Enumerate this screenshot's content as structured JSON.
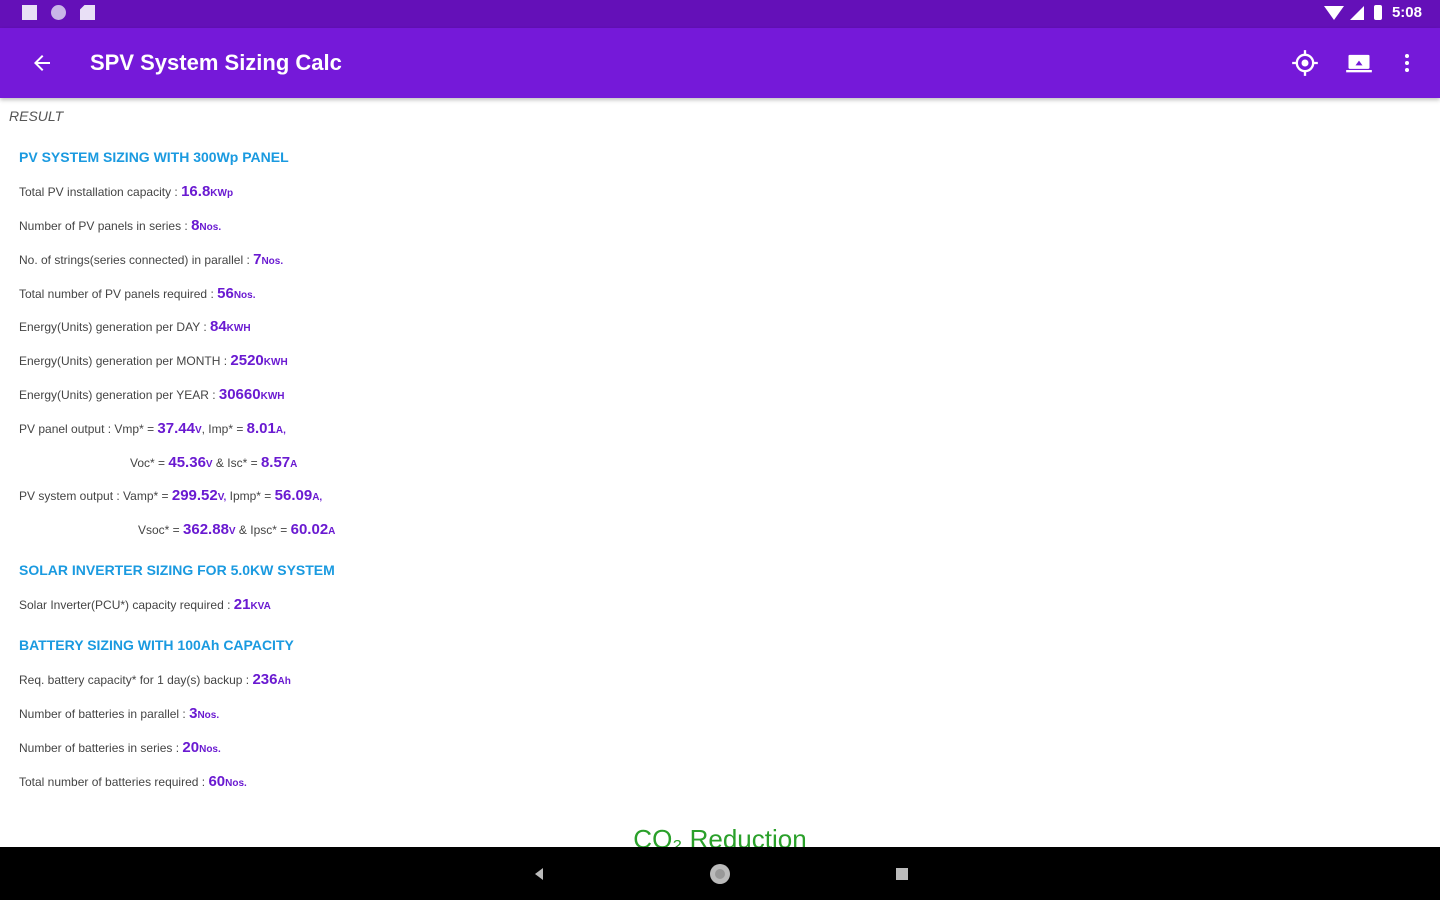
{
  "status_bar": {
    "time": "5:08"
  },
  "app_bar": {
    "title": "SPV System Sizing Calc"
  },
  "result_label": "RESULT",
  "pv_section": {
    "heading": "PV SYSTEM SIZING WITH 300Wp PANEL",
    "rows": [
      {
        "label": "Total PV installation capacity : ",
        "value": "16.8",
        "unit": "KWp"
      },
      {
        "label": "Number of PV panels in series : ",
        "value": "8",
        "unit": "Nos."
      },
      {
        "label": "No. of strings(series connected) in parallel : ",
        "value": "7",
        "unit": "Nos."
      },
      {
        "label": "Total number of PV panels required : ",
        "value": "56",
        "unit": "Nos."
      },
      {
        "label": "Energy(Units) generation per DAY : ",
        "value": "84",
        "unit": "KWH"
      },
      {
        "label": "Energy(Units) generation per MONTH : ",
        "value": "2520",
        "unit": "KWH"
      },
      {
        "label": "Energy(Units) generation per YEAR : ",
        "value": "30660",
        "unit": "KWH"
      }
    ],
    "panel_output": {
      "label": "PV panel output : Vmp* = ",
      "vmp": "37.44",
      "vmp_unit": "V",
      "imp_label": ", Imp* = ",
      "imp": "8.01",
      "imp_unit": "A,",
      "voc_label": "Voc* = ",
      "voc": "45.36",
      "voc_unit": "V",
      "isc_label": " & Isc* = ",
      "isc": "8.57",
      "isc_unit": "A"
    },
    "system_output": {
      "label": "PV system output : Vamp* = ",
      "vmp": "299.52",
      "vmp_unit": "V,",
      "imp_label": " Ipmp* = ",
      "imp": "56.09",
      "imp_unit": "A,",
      "voc_label": "Vsoc* = ",
      "voc": "362.88",
      "voc_unit": "V",
      "isc_label": " & Ipsc* = ",
      "isc": "60.02",
      "isc_unit": "A"
    }
  },
  "inverter_section": {
    "heading": "SOLAR INVERTER SIZING FOR 5.0KW SYSTEM",
    "row": {
      "label": "Solar Inverter(PCU*) capacity required : ",
      "value": "21",
      "unit": "KVA"
    }
  },
  "battery_section": {
    "heading": "BATTERY SIZING WITH 100Ah CAPACITY",
    "rows": [
      {
        "label": "Req. battery capacity* for 1 day(s) backup : ",
        "value": "236",
        "unit": "Ah"
      },
      {
        "label": "Number of batteries in parallel : ",
        "value": "3",
        "unit": "Nos."
      },
      {
        "label": "Number of batteries in series : ",
        "value": "20",
        "unit": "Nos."
      },
      {
        "label": "Total number of batteries required : ",
        "value": "60",
        "unit": "Nos."
      }
    ]
  },
  "co2_heading": "CO₂ Reduction"
}
